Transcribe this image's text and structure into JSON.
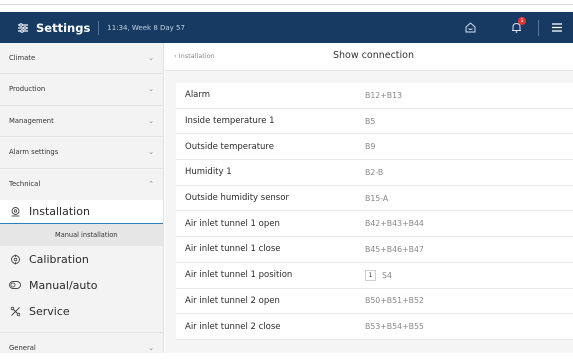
{
  "header": {
    "title": "Settings",
    "timestamp": "11:34, Week 8 Day 57",
    "notification_count": "1",
    "colors": {
      "bar": "#173a63",
      "badge": "#e3342f"
    }
  },
  "sidebar": {
    "sections": [
      {
        "label": "Climate"
      },
      {
        "label": "Production"
      },
      {
        "label": "Management"
      },
      {
        "label": "Alarm settings"
      },
      {
        "label": "Technical"
      },
      {
        "label": "General"
      }
    ],
    "technical_items": [
      {
        "label": "Installation",
        "icon": "installation-icon"
      },
      {
        "label": "Calibration",
        "icon": "calibration-icon"
      },
      {
        "label": "Manual/auto",
        "icon": "manual-auto-icon"
      },
      {
        "label": "Service",
        "icon": "service-icon"
      }
    ],
    "installation_sub": "Manual installation"
  },
  "content": {
    "breadcrumb": "Installation",
    "page_title": "Show connection",
    "rows": [
      {
        "label": "Alarm",
        "value": "B12+B13"
      },
      {
        "label": "Inside temperature 1",
        "value": "B5"
      },
      {
        "label": "Outside temperature",
        "value": "B9"
      },
      {
        "label": "Humidity 1",
        "value": "B2-B"
      },
      {
        "label": "Outside humidity sensor",
        "value": "B15-A"
      },
      {
        "label": "Air inlet tunnel 1 open",
        "value": "B42+B43+B44"
      },
      {
        "label": "Air inlet tunnel 1 close",
        "value": "B45+B46+B47"
      },
      {
        "label": "Air inlet tunnel 1 position",
        "box": "1",
        "value": "S4"
      },
      {
        "label": "Air inlet tunnel 2 open",
        "value": "B50+B51+B52"
      },
      {
        "label": "Air inlet tunnel 2 close",
        "value": "B53+B54+B55"
      }
    ]
  }
}
